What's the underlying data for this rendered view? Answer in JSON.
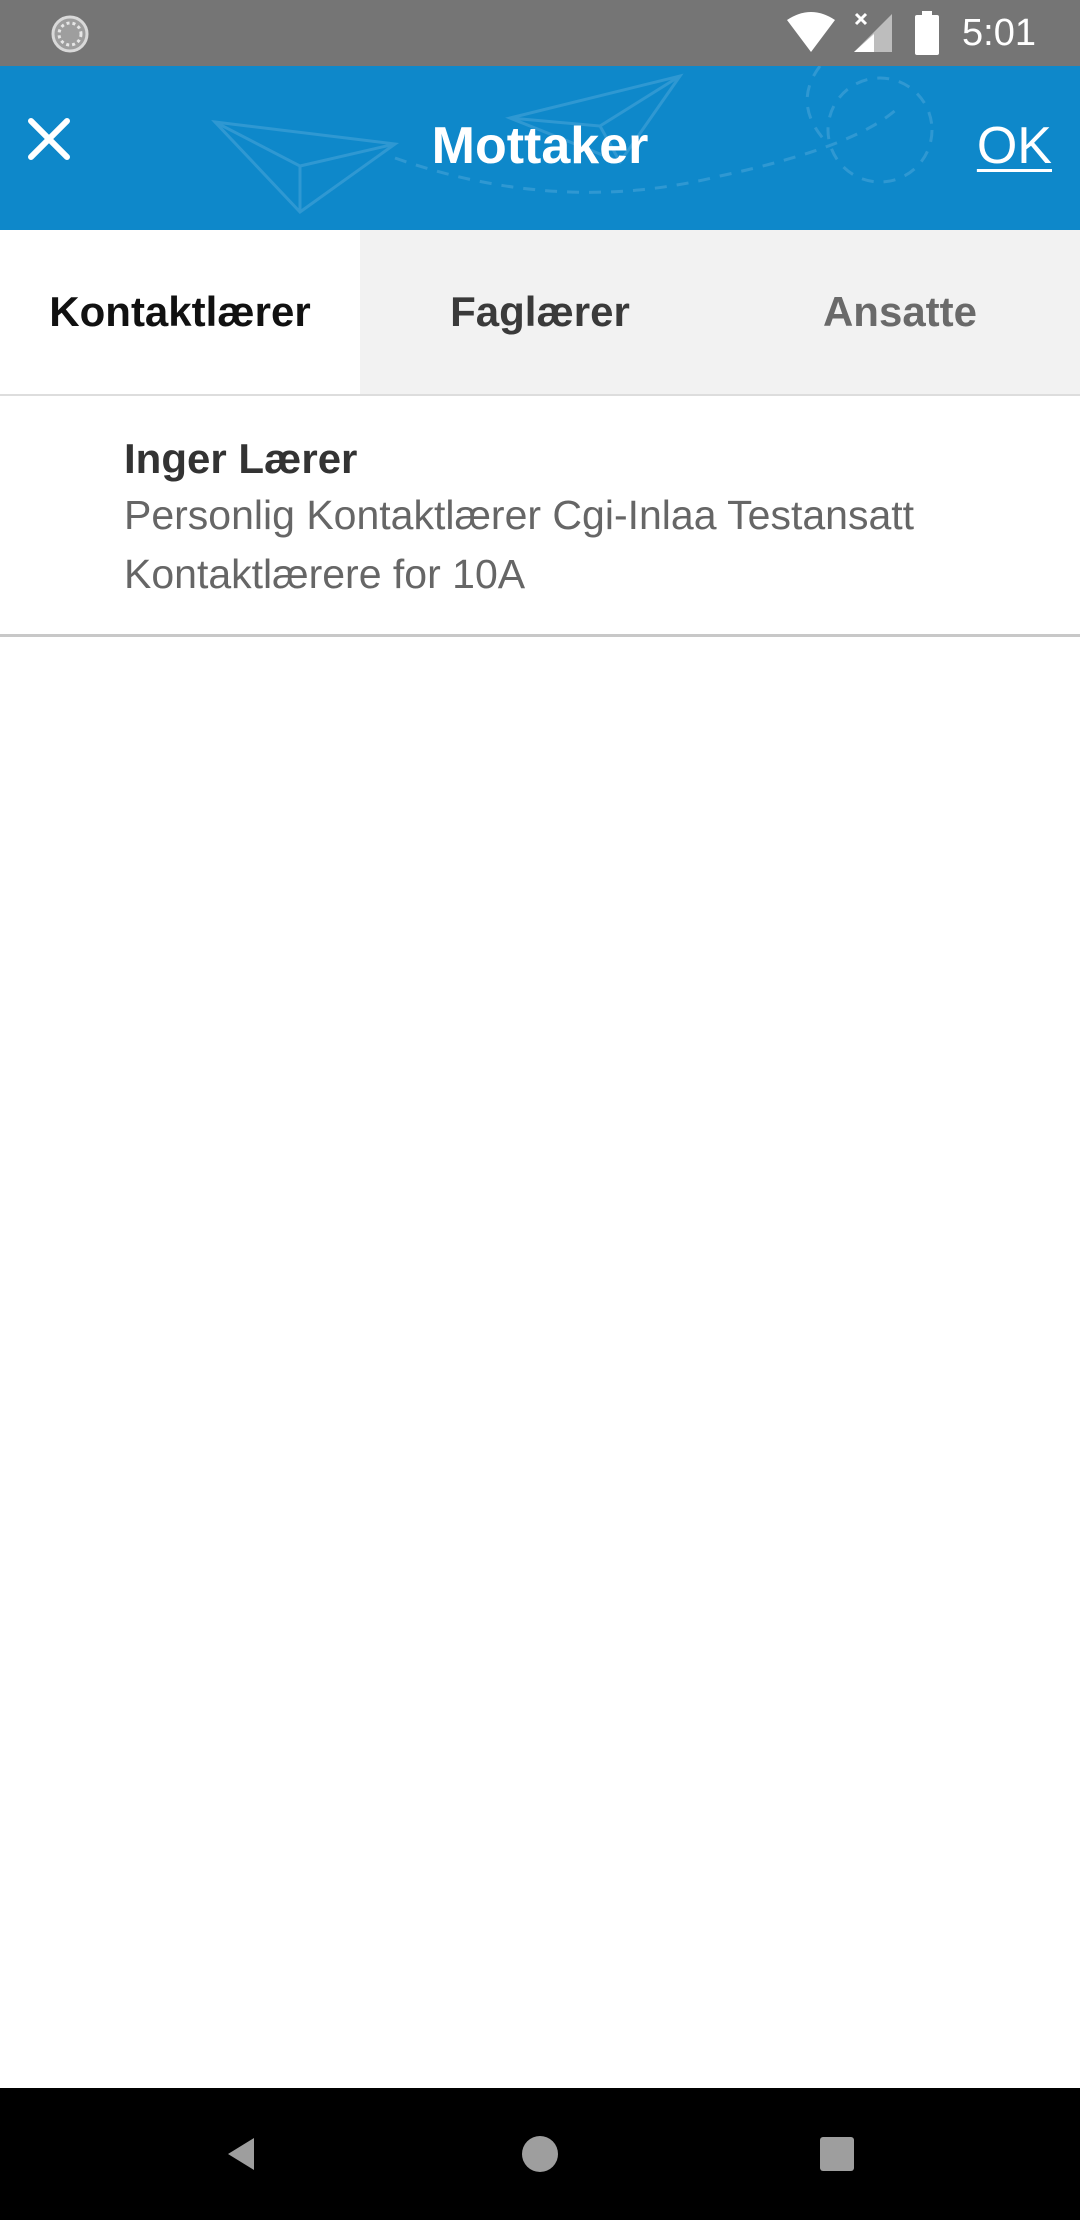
{
  "status_bar": {
    "time": "5:01",
    "icons": [
      "sync-icon",
      "wifi-icon",
      "cellular-no-signal-icon",
      "battery-icon"
    ]
  },
  "app_bar": {
    "title": "Mottaker",
    "close_icon": "close-icon",
    "ok_label": "OK",
    "background_color": "#0e88ca"
  },
  "tabs": [
    {
      "label": "Kontaktlærer",
      "selected": true
    },
    {
      "label": "Faglærer",
      "selected": false
    },
    {
      "label": "Ansatte",
      "selected": false
    }
  ],
  "recipients": [
    {
      "name": "Inger Lærer",
      "line1": "Personlig Kontaktlærer Cgi-Inlaa Testansatt",
      "line2": "Kontaktlærere for 10A"
    }
  ],
  "nav_bar": {
    "icons": [
      "back-icon",
      "home-icon",
      "recents-icon"
    ]
  }
}
